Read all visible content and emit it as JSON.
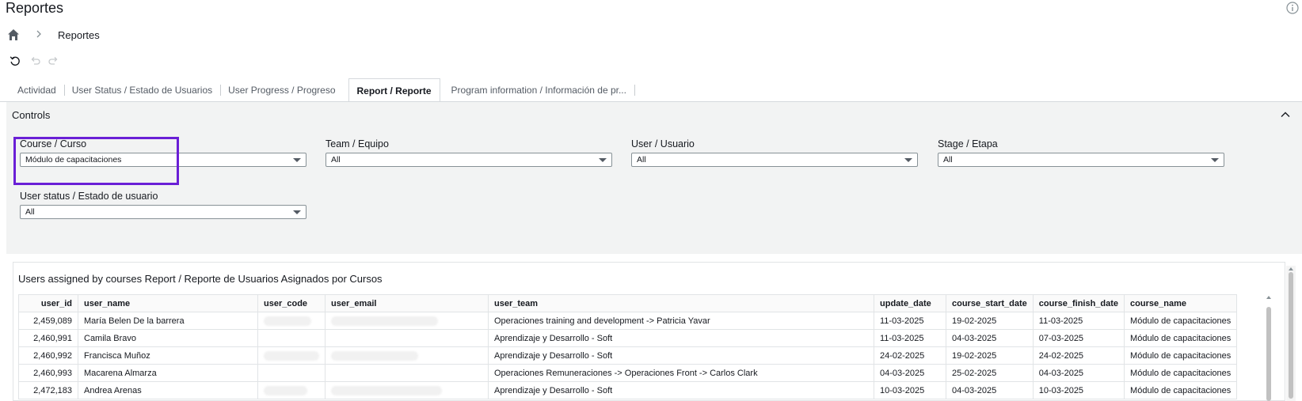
{
  "page": {
    "title": "Reportes"
  },
  "breadcrumb": {
    "current": "Reportes"
  },
  "tabs": [
    {
      "label": "Actividad"
    },
    {
      "label": "User Status / Estado de Usuarios"
    },
    {
      "label": "User Progress / Progreso"
    },
    {
      "label": "Report / Reporte"
    },
    {
      "label": "Program information / Información de pr..."
    }
  ],
  "controls": {
    "title": "Controls",
    "filters": {
      "course": {
        "label": "Course / Curso",
        "value": "Módulo de capacitaciones"
      },
      "team": {
        "label": "Team / Equipo",
        "value": "All"
      },
      "user": {
        "label": "User / Usuario",
        "value": "All"
      },
      "stage": {
        "label": "Stage / Etapa",
        "value": "All"
      },
      "status": {
        "label": "User status / Estado de usuario",
        "value": "All"
      }
    }
  },
  "report": {
    "title": "Users assigned by courses Report / Reporte de Usuarios Asignados por Cursos",
    "columns": [
      "user_id",
      "user_name",
      "user_code",
      "user_email",
      "user_team",
      "update_date",
      "course_start_date",
      "course_finish_date",
      "course_name"
    ],
    "rows": [
      [
        "2,459,089",
        "María Belen De la barrera",
        "",
        "",
        "Operaciones training and development -> Patricia Yavar",
        "11-03-2025",
        "19-02-2025",
        "11-03-2025",
        "Módulo de capacitaciones"
      ],
      [
        "2,460,991",
        "Camila Bravo",
        "",
        "",
        "Aprendizaje y Desarrollo - Soft",
        "11-03-2025",
        "04-03-2025",
        "07-03-2025",
        "Módulo de capacitaciones"
      ],
      [
        "2,460,992",
        "Francisca Muñoz",
        "",
        "",
        "Aprendizaje y Desarrollo - Soft",
        "24-02-2025",
        "19-02-2025",
        "24-02-2025",
        "Módulo de capacitaciones"
      ],
      [
        "2,460,993",
        "Macarena Almarza",
        "",
        "",
        "Operaciones Remuneraciones -> Operaciones Front -> Carlos Clark",
        "04-03-2025",
        "25-02-2025",
        "04-03-2025",
        "Módulo de capacitaciones"
      ],
      [
        "2,472,183",
        "Andrea Arenas",
        "",
        "",
        "Aprendizaje y Desarrollo - Soft",
        "10-03-2025",
        "04-03-2025",
        "10-03-2025",
        "Módulo de capacitaciones"
      ]
    ]
  }
}
